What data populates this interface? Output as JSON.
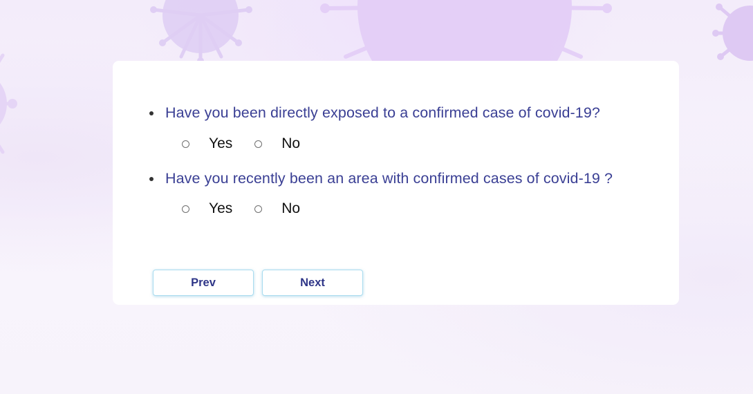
{
  "questions": [
    {
      "text": "Have you been directly exposed to a confirmed case of covid-19?",
      "options": [
        "Yes",
        "No"
      ]
    },
    {
      "text": "Have you recently been an area with confirmed cases of covid-19 ?",
      "options": [
        "Yes",
        "No"
      ]
    }
  ],
  "buttons": {
    "prev_label": "Prev",
    "next_label": "Next"
  },
  "colors": {
    "question_text": "#3a3f94",
    "button_text": "#2e3587",
    "button_border": "#a9dcef",
    "background": "#f6f1fb",
    "virus_decoration": "#d9c3f2"
  },
  "icons": {
    "background_decoration": "virus-icon",
    "option_control": "radio-circle-icon"
  }
}
